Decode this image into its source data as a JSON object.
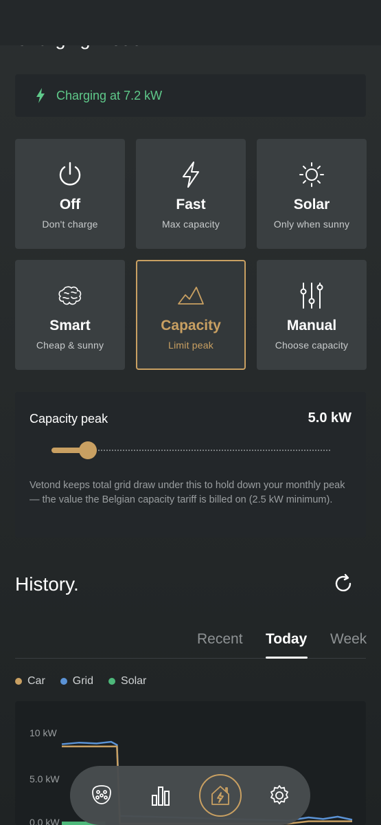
{
  "header": {
    "section_title": "Charging mode."
  },
  "status": {
    "text": "Charging at 7.2 kW",
    "color": "#5fc98a"
  },
  "modes": [
    {
      "title": "Off",
      "subtitle": "Don't charge",
      "icon": "power-icon",
      "active": false
    },
    {
      "title": "Fast",
      "subtitle": "Max capacity",
      "icon": "bolt-icon",
      "active": false
    },
    {
      "title": "Solar",
      "subtitle": "Only when sunny",
      "icon": "sun-icon",
      "active": false
    },
    {
      "title": "Smart",
      "subtitle": "Cheap & sunny",
      "icon": "brain-icon",
      "active": false
    },
    {
      "title": "Capacity",
      "subtitle": "Limit peak",
      "icon": "mountain-peak-icon",
      "active": true
    },
    {
      "title": "Manual",
      "subtitle": "Choose capacity",
      "icon": "sliders-icon",
      "active": false
    }
  ],
  "capacity": {
    "label": "Capacity peak",
    "value_text": "5.0 kW",
    "slider_fraction": 0.13,
    "description": "Vetond keeps total grid draw under this to hold down your monthly peak — the value the Belgian capacity tariff is billed on (2.5 kW minimum)."
  },
  "history": {
    "title": "History.",
    "tabs": [
      {
        "label": "Recent",
        "active": false
      },
      {
        "label": "Today",
        "active": true
      },
      {
        "label": "Week",
        "active": false
      }
    ],
    "legend": [
      {
        "name": "Car",
        "color": "#c9a062"
      },
      {
        "name": "Grid",
        "color": "#5b93d6"
      },
      {
        "name": "Solar",
        "color": "#4db87a"
      }
    ]
  },
  "chart_data": {
    "type": "line",
    "ytick_labels": [
      "10 kW",
      "5.0 kW",
      "0.0 kW"
    ],
    "ylim": [
      0,
      10
    ],
    "series": [
      {
        "name": "Grid",
        "color": "#5b93d6",
        "points": [
          [
            0,
            10.3
          ],
          [
            0.06,
            10.5
          ],
          [
            0.12,
            10.4
          ],
          [
            0.17,
            10.6
          ],
          [
            0.19,
            10.2
          ],
          [
            0.2,
            1.0
          ],
          [
            0.78,
            0.4
          ],
          [
            0.85,
            0.8
          ],
          [
            0.9,
            0.6
          ],
          [
            0.95,
            0.9
          ],
          [
            1.0,
            0.5
          ]
        ]
      },
      {
        "name": "Car",
        "color": "#c9a062",
        "points": [
          [
            0,
            10.0
          ],
          [
            0.19,
            10.0
          ],
          [
            0.2,
            0
          ],
          [
            0.78,
            0
          ],
          [
            0.85,
            0.3
          ],
          [
            1.0,
            0.3
          ]
        ]
      },
      {
        "name": "Solar",
        "color": "#4db87a",
        "points": [
          [
            0,
            0
          ],
          [
            0.15,
            0
          ]
        ]
      }
    ]
  },
  "nav": {
    "items": [
      {
        "icon": "ev-plug-icon"
      },
      {
        "icon": "bar-chart-icon"
      },
      {
        "icon": "home-charge-icon",
        "active": true
      },
      {
        "icon": "gear-icon"
      }
    ],
    "accent": "#c9a062"
  }
}
